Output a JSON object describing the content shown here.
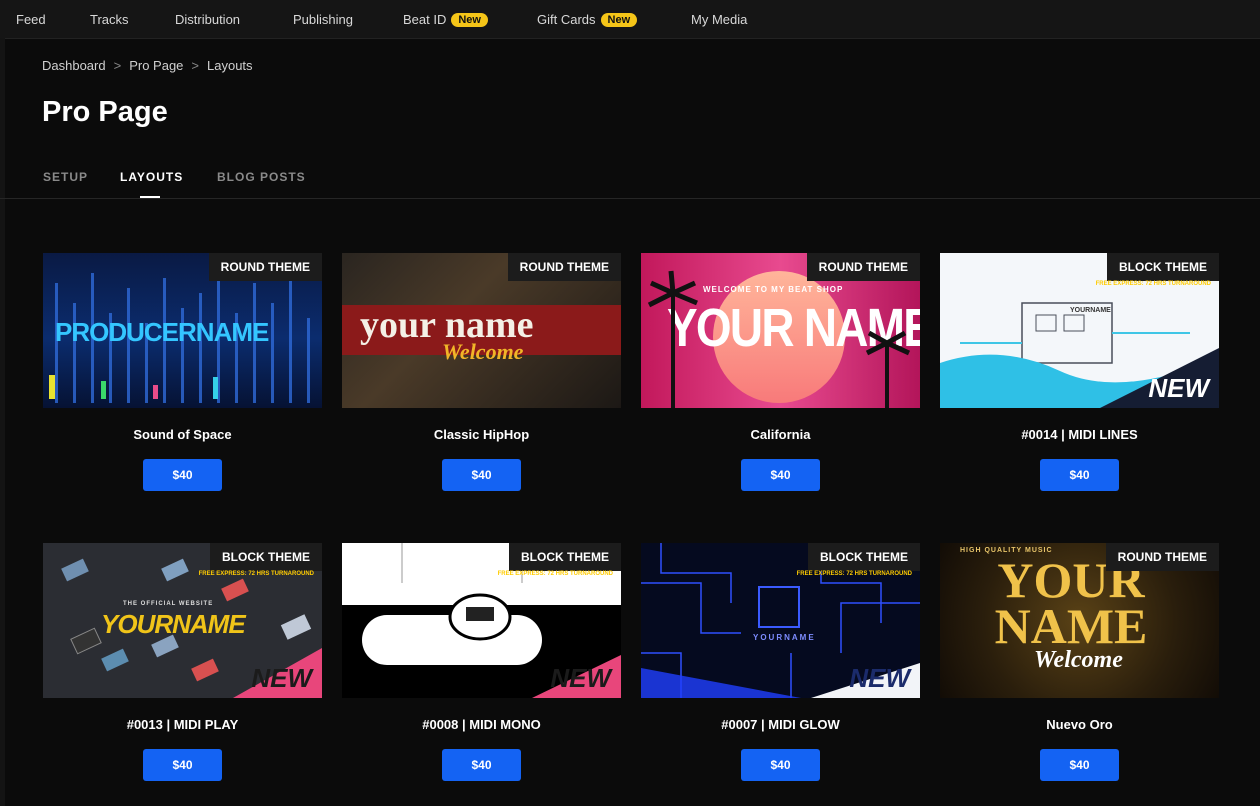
{
  "nav": {
    "feed": "Feed",
    "tracks": "Tracks",
    "distribution": "Distribution",
    "publishing": "Publishing",
    "beat_id": "Beat ID",
    "gift_cards": "Gift Cards",
    "my_media": "My Media",
    "new_badge": "New"
  },
  "breadcrumb": {
    "dashboard": "Dashboard",
    "sep": ">",
    "pro_page": "Pro Page",
    "layouts": "Layouts"
  },
  "page_title": "Pro Page",
  "tabs": {
    "setup": "SETUP",
    "layouts": "LAYOUTS",
    "blog_posts": "BLOG POSTS"
  },
  "express_text": "FREE EXPRESS: 72 HRS TURNAROUND",
  "new_text": "NEW",
  "cards": [
    {
      "name": "Sound of Space",
      "theme": "ROUND THEME",
      "price": "$40",
      "art_text": "PRODUCERNAME"
    },
    {
      "name": "Classic HipHop",
      "theme": "ROUND THEME",
      "price": "$40",
      "art_text": "your name",
      "art_sub": "Welcome"
    },
    {
      "name": "California",
      "theme": "ROUND THEME",
      "price": "$40",
      "art_text": "YOUR NAME",
      "art_sub": "WELCOME TO MY BEAT SHOP"
    },
    {
      "name": "#0014 | MIDI LINES",
      "theme": "BLOCK THEME",
      "price": "$40",
      "art_text": "YOURNAME"
    },
    {
      "name": "#0013 | MIDI PLAY",
      "theme": "BLOCK THEME",
      "price": "$40",
      "art_text": "YOURNAME",
      "art_sub": "THE OFFICIAL WEBSITE"
    },
    {
      "name": "#0008 | MIDI MONO",
      "theme": "BLOCK THEME",
      "price": "$40",
      "art_text": ""
    },
    {
      "name": "#0007 | MIDI GLOW",
      "theme": "BLOCK THEME",
      "price": "$40",
      "art_text": "YOURNAME"
    },
    {
      "name": "Nuevo Oro",
      "theme": "ROUND THEME",
      "price": "$40",
      "art_text": "YOUR NAME",
      "art_sub": "Welcome",
      "art_top": "HIGH QUALITY MUSIC"
    }
  ]
}
